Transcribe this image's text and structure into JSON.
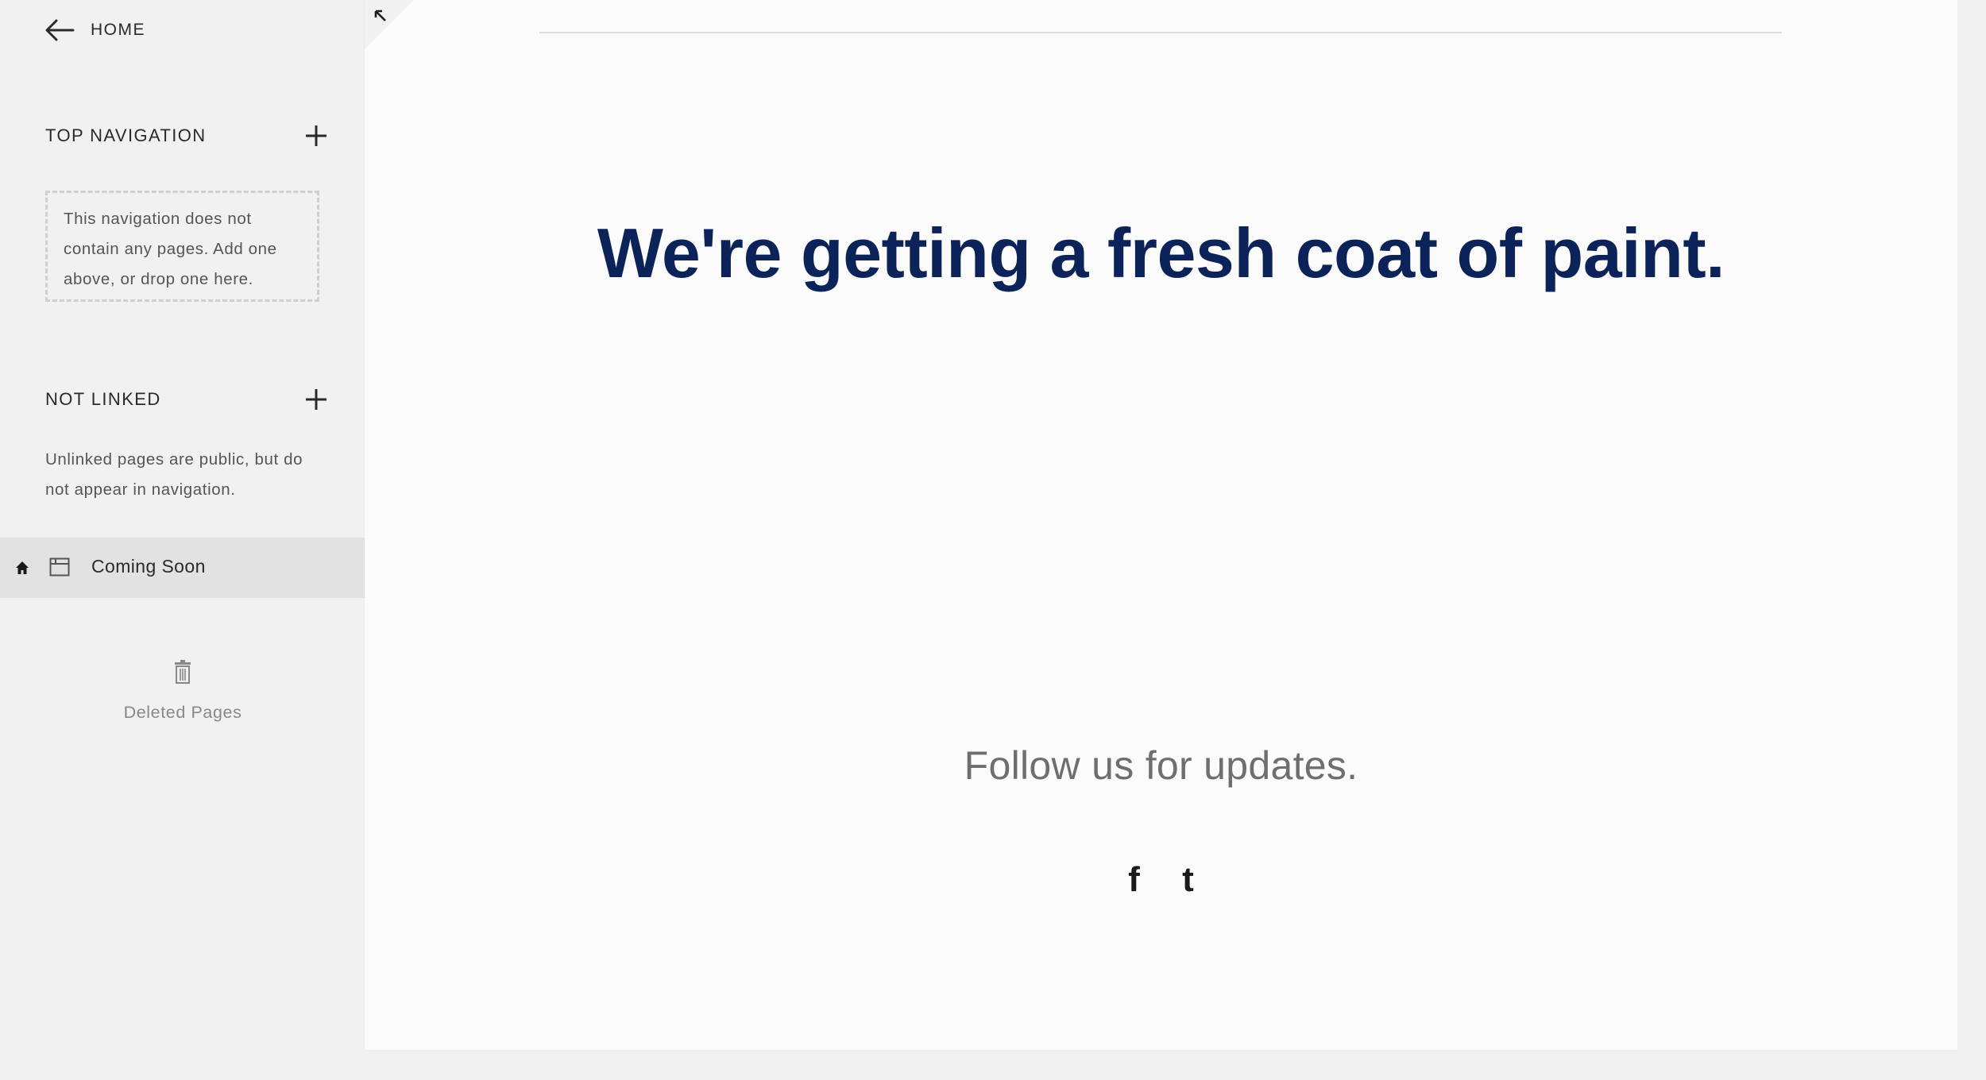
{
  "sidebar": {
    "home_label": "HOME",
    "top_nav": {
      "title": "TOP NAVIGATION",
      "empty_message": "This navigation does not contain any pages. Add one above, or drop one here."
    },
    "not_linked": {
      "title": "NOT LINKED",
      "note": "Unlinked pages are public, but do not appear in navigation."
    },
    "pages": [
      {
        "title": "Coming Soon",
        "is_homepage": true,
        "selected": true
      }
    ],
    "deleted_label": "Deleted Pages"
  },
  "preview": {
    "headline": "We're getting a fresh coat of paint.",
    "follow_text": "Follow us for updates.",
    "social": [
      {
        "name": "facebook",
        "glyph": "f"
      },
      {
        "name": "tumblr",
        "glyph": "t"
      }
    ],
    "brand_color": "#0c2359"
  },
  "icons": {
    "back": "arrow-left-icon",
    "add": "plus-icon",
    "home": "home-icon",
    "page": "page-icon",
    "trash": "trash-icon",
    "collapse": "collapse-arrow-icon",
    "art": "paint-can-brush-icon"
  }
}
